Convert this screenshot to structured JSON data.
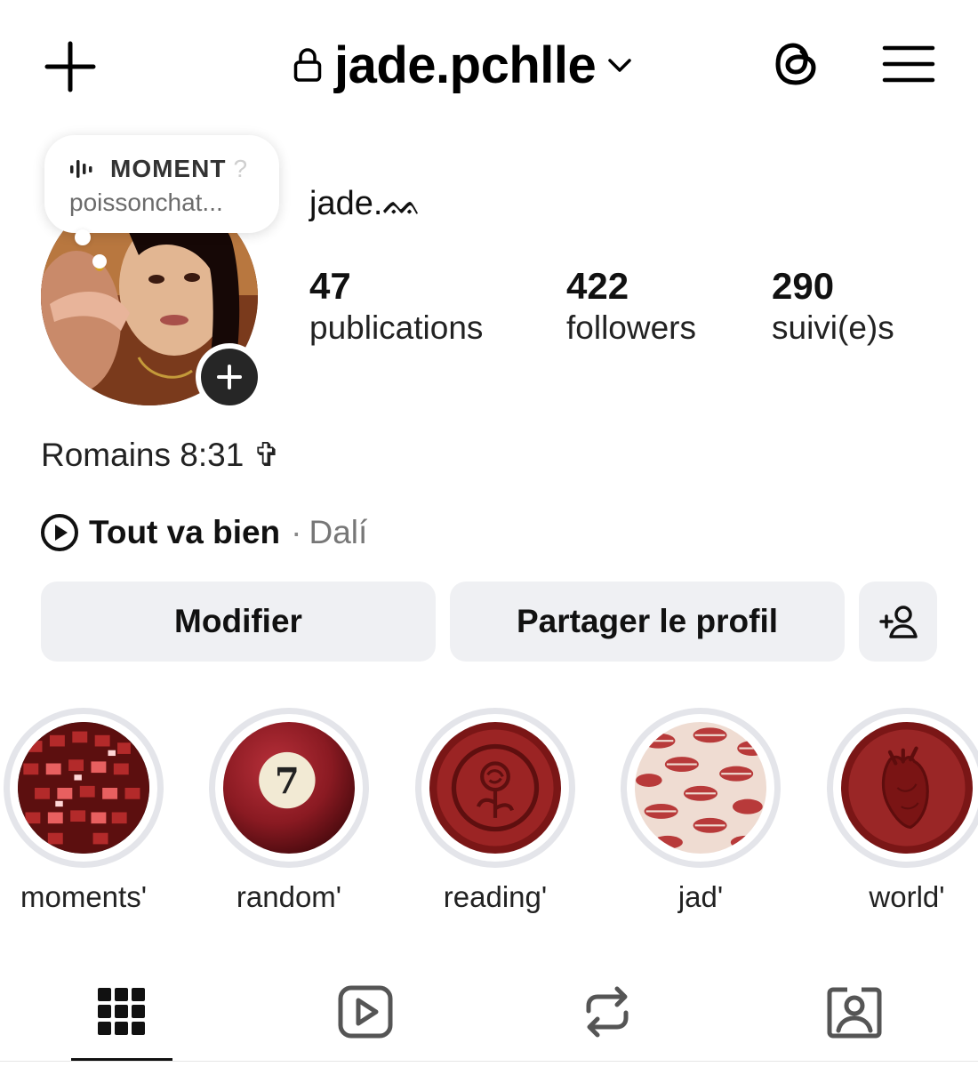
{
  "header": {
    "username": "jade.pchlle",
    "icons": {
      "create": "plus-icon",
      "lock": "lock-icon",
      "switch": "chevron-down-icon",
      "threads": "threads-icon",
      "menu": "hamburger-menu-icon"
    }
  },
  "note": {
    "title": "MOMENT",
    "title_suffix": "?",
    "subtitle": "poissonchat..."
  },
  "profile": {
    "display_name": "jade.ᨐ",
    "stats": [
      {
        "value": "47",
        "label": "publications"
      },
      {
        "value": "422",
        "label": "followers"
      },
      {
        "value": "290",
        "label": "suivi(e)s"
      }
    ],
    "bio": "Romains 8:31 ✞",
    "music": {
      "title": "Tout va bien",
      "separator": "·",
      "artist": "Dalí"
    }
  },
  "actions": {
    "edit_label": "Modifier",
    "share_label": "Partager le profil"
  },
  "highlights": [
    {
      "label": "moments'",
      "theme": "disco-ball"
    },
    {
      "label": "random'",
      "theme": "pool-ball-7",
      "badge": "7"
    },
    {
      "label": "reading'",
      "theme": "wax-seal-rose"
    },
    {
      "label": "jad'",
      "theme": "lips-pattern"
    },
    {
      "label": "world'",
      "theme": "wax-seal-heart"
    }
  ],
  "tabs": [
    {
      "icon": "grid-icon",
      "active": true
    },
    {
      "icon": "reels-icon",
      "active": false
    },
    {
      "icon": "reposts-icon",
      "active": false
    },
    {
      "icon": "tagged-icon",
      "active": false
    }
  ],
  "colors": {
    "accent_dark": "#262626",
    "button_bg": "#eff0f3",
    "ring": "#e4e5ea",
    "seal_red": "#8c1d1d"
  }
}
